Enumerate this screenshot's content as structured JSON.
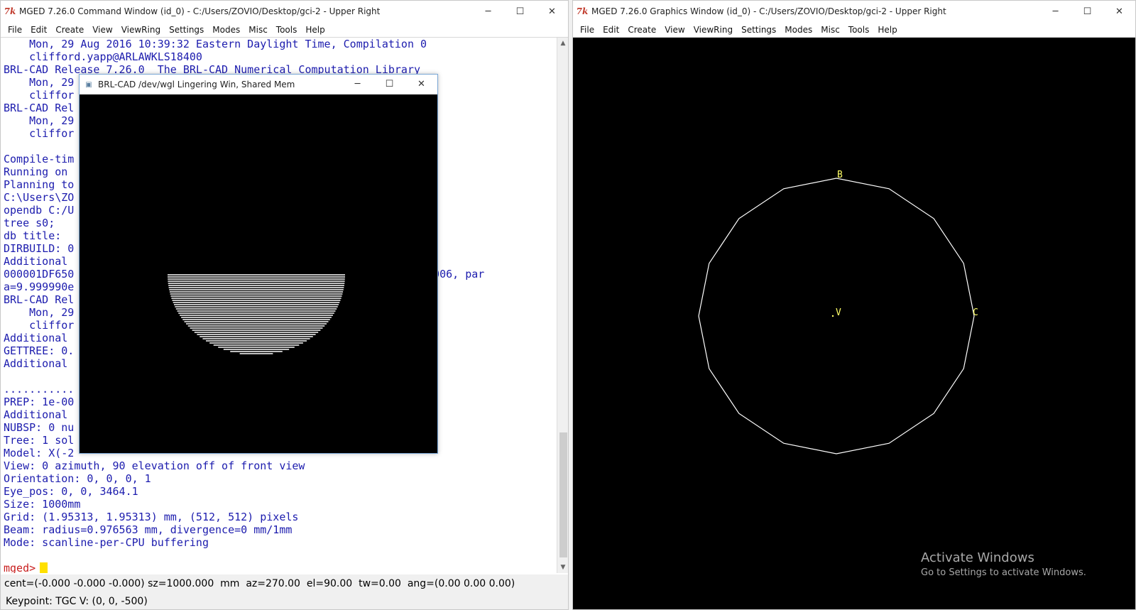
{
  "command_window": {
    "title": "MGED 7.26.0 Command Window (id_0) - C:/Users/ZOVIO/Desktop/gci-2 - Upper Right",
    "app_icon": "tk-icon",
    "menu": [
      "File",
      "Edit",
      "Create",
      "View",
      "ViewRing",
      "Settings",
      "Modes",
      "Misc",
      "Tools",
      "Help"
    ],
    "console_lines": [
      "    Mon, 29 Aug 2016 10:39:32 Eastern Daylight Time, Compilation 0",
      "    clifford.yapp@ARLAWKLS18400",
      "BRL-CAD Release 7.26.0  The BRL-CAD Numerical Computation Library",
      "    Mon, 29                                                 ion 0",
      "    cliffor",
      "BRL-CAD Rel",
      "    Mon, 29                                                 ion 0",
      "    cliffor",
      "",
      "Compile-tim",
      "Running on",
      "Planning to",
      "C:\\Users\\ZO",
      "opendb C:/U",
      "tree s0;",
      "db title:",
      "DIRBUILD: 0",
      "Additional",
      "000001DF650                                                000000e-006, par",
      "a=9.999990e",
      "BRL-CAD Rel",
      "    Mon, 29                                                 ion 0",
      "    cliffor",
      "Additional",
      "GETTREE: 0.",
      "Additional",
      "",
      "...........",
      "PREP: 1e-00",
      "Additional",
      "NUBSP: 0 nu",
      "Tree: 1 sol",
      "Model: X(-2",
      "View: 0 azimuth, 90 elevation off of front view",
      "Orientation: 0, 0, 0, 1",
      "Eye_pos: 0, 0, 3464.1",
      "Size: 1000mm",
      "Grid: (1.95313, 1.95313) mm, (512, 512) pixels",
      "Beam: radius=0.976563 mm, divergence=0 mm/1mm",
      "Mode: scanline-per-CPU buffering",
      ""
    ],
    "prompt": "mged>",
    "status_line": "cent=(-0.000 -0.000 -0.000) sz=1000.000  mm  az=270.00  el=90.00  tw=0.00  ang=(0.00 0.00 0.00)",
    "keypoint_line": "Keypoint: TGC V: (0, 0, -500)"
  },
  "graphics_window": {
    "title": "MGED 7.26.0 Graphics Window (id_0) - C:/Users/ZOVIO/Desktop/gci-2 - Upper Right",
    "app_icon": "tk-icon",
    "menu": [
      "File",
      "Edit",
      "Create",
      "View",
      "ViewRing",
      "Settings",
      "Modes",
      "Misc",
      "Tools",
      "Help"
    ],
    "labels": {
      "b": "B",
      "v": "V",
      "c": "C"
    },
    "wireframe_color": "#ffffff",
    "label_color": "#ffff66",
    "activate_title": "Activate Windows",
    "activate_sub": "Go to Settings to activate Windows."
  },
  "framebuffer_window": {
    "title": "BRL-CAD /dev/wgl Lingering Win, Shared Mem",
    "scanline_color": "#ffffff"
  },
  "window_controls": {
    "minimize": "─",
    "maximize": "☐",
    "close": "✕"
  }
}
